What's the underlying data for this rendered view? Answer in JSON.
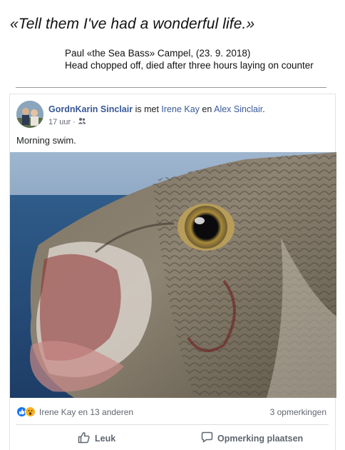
{
  "header": {
    "quote": "«Tell them I've had a wonderful life.»",
    "caption_line1": "Paul «the Sea Bass» Campel,  (23. 9. 2018)",
    "caption_line2": "Head chopped off, died after three hours laying on counter"
  },
  "post": {
    "author": "GordnKarin Sinclair",
    "with_text": "is met",
    "tag1": "Irene Kay",
    "conjunction": "en",
    "tag2": "Alex Sinclair",
    "timestamp": "17 uur",
    "separator": "·",
    "audience_icon": "friends-icon",
    "text": "Morning swim.",
    "photo_icon": "sea-bass-photo"
  },
  "footer": {
    "reactors": "Irene Kay en 13 anderen",
    "comments": "3 opmerkingen",
    "like_label": "Leuk",
    "comment_label": "Opmerking plaatsen"
  },
  "colors": {
    "link": "#385898",
    "like_blue": "#1877f2",
    "wow_yellow": "#f7b125",
    "muted": "#616770"
  }
}
